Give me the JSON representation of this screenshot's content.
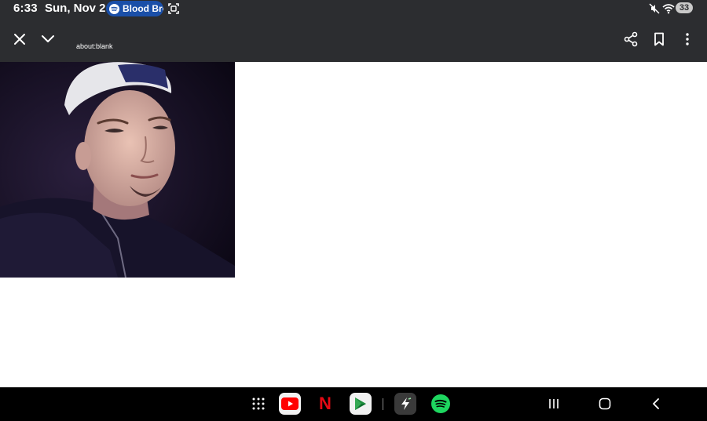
{
  "status_bar": {
    "time": "6:33",
    "date": "Sun, Nov 2",
    "media_text": "Blood Brothers",
    "battery": "33",
    "icons": [
      "spotify-icon",
      "screenshot-icon",
      "mute-icon",
      "wifi-icon"
    ]
  },
  "toolbar": {
    "url": "about:blank",
    "icons": [
      "close-icon",
      "chevron-down-icon",
      "share-icon",
      "bookmark-icon",
      "more-vert-icon"
    ]
  },
  "page": {
    "image": "portrait-photo"
  },
  "taskbar": {
    "apps": [
      "app-drawer-icon",
      "youtube-icon",
      "netflix-icon",
      "google-play-games-icon",
      "flash-app-icon",
      "spotify-icon"
    ],
    "netflix_letter": "N",
    "nav": [
      "recents-icon",
      "home-icon",
      "back-icon"
    ]
  },
  "colors": {
    "bar_bg": "#2c2d30",
    "pill_bg": "#1a4fa8",
    "spotify": "#1ed760",
    "youtube": "#ff0000",
    "netflix": "#e50914"
  }
}
